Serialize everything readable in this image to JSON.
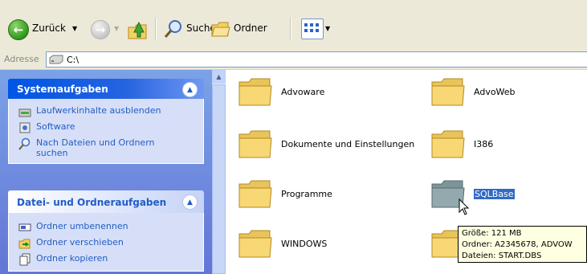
{
  "toolbar": {
    "back_label": "Zurück",
    "search_label": "Suchen",
    "folders_label": "Ordner"
  },
  "address": {
    "label": "Adresse",
    "value": "C:\\"
  },
  "taskpane": {
    "system_tasks": {
      "title": "Systemaufgaben",
      "items": [
        {
          "label": "Laufwerkinhalte ausblenden",
          "icon": "hide-drive-icon"
        },
        {
          "label": "Software",
          "icon": "software-icon"
        },
        {
          "label": "Nach Dateien und Ordnern suchen",
          "icon": "search-files-icon"
        }
      ]
    },
    "file_tasks": {
      "title": "Datei- und Ordneraufgaben",
      "items": [
        {
          "label": "Ordner umbenennen",
          "icon": "rename-icon"
        },
        {
          "label": "Ordner verschieben",
          "icon": "move-icon"
        },
        {
          "label": "Ordner kopieren",
          "icon": "copy-icon"
        }
      ]
    }
  },
  "files": [
    {
      "name": "Advoware",
      "selected": false
    },
    {
      "name": "AdvoWeb",
      "selected": false
    },
    {
      "name": "Dokumente und Einstellungen",
      "selected": false
    },
    {
      "name": "I386",
      "selected": false
    },
    {
      "name": "Programme",
      "selected": false
    },
    {
      "name": "SQLBase",
      "selected": true
    },
    {
      "name": "WINDOWS",
      "selected": false
    }
  ],
  "tooltip": {
    "lines": [
      "Größe: 121 MB",
      "Ordner: A2345678, ADVOW",
      "Dateien: START.DBS"
    ]
  },
  "colors": {
    "accent": "#316ac5",
    "task_link": "#215dc6",
    "folder_yellow": "#f8d775"
  }
}
